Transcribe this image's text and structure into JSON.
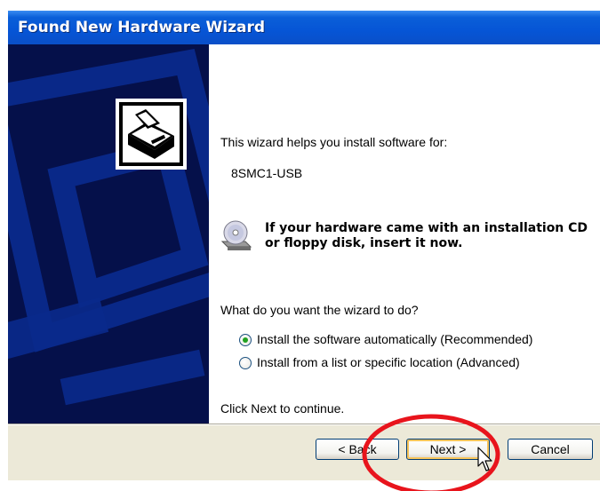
{
  "window": {
    "title": "Found New Hardware Wizard"
  },
  "content": {
    "intro": "This wizard helps you install software for:",
    "device_name": "8SMC1-USB",
    "cd_notice_line1": "If your hardware came with an installation CD",
    "cd_notice_line2": "or floppy disk, insert it now.",
    "question": "What do you want the wizard to do?",
    "options": [
      {
        "label": "Install the software automatically (Recommended)",
        "selected": true
      },
      {
        "label": "Install from a list or specific location (Advanced)",
        "selected": false
      }
    ],
    "footer_hint": "Click Next to continue."
  },
  "buttons": {
    "back": "< Back",
    "next": "Next >",
    "cancel": "Cancel"
  },
  "icons": [
    "hardware-install-icon",
    "cd-drive-icon",
    "mouse-cursor-icon"
  ],
  "colors": {
    "title_bar": "#0655d6",
    "left_panel": "#05104a",
    "highlight_circle": "#e8141c",
    "radio_selected": "#21a121"
  }
}
